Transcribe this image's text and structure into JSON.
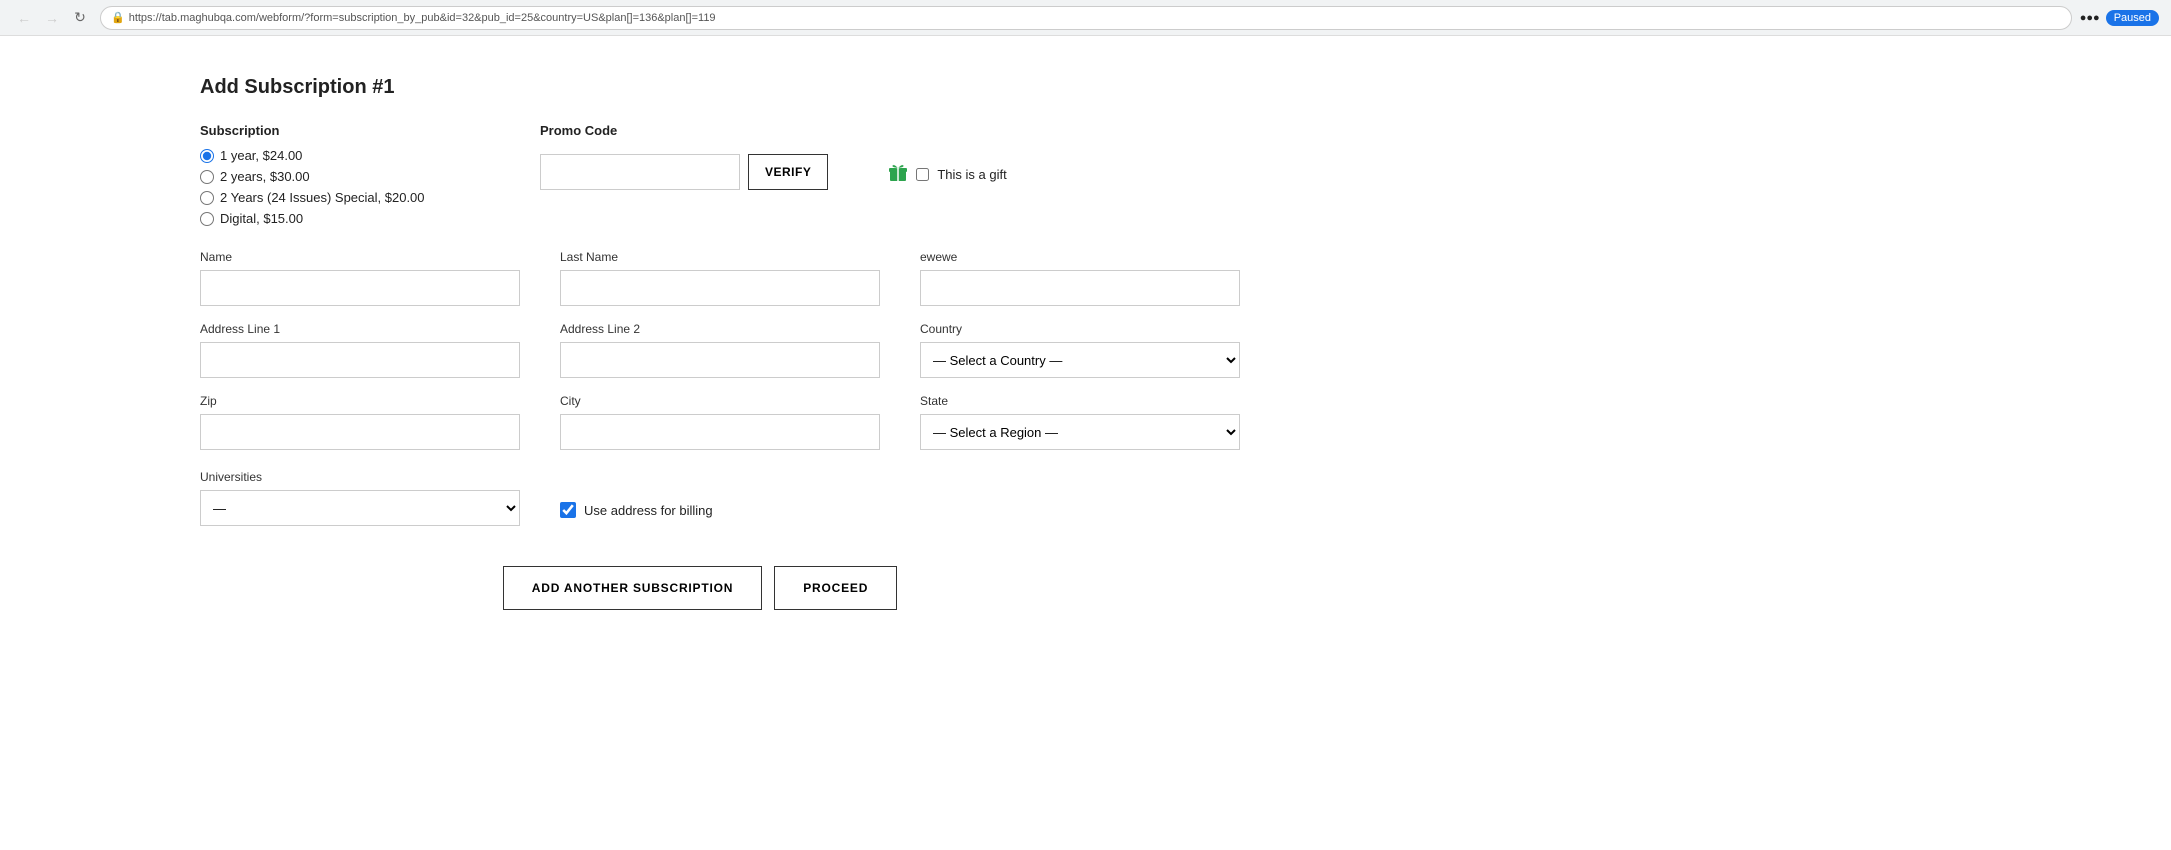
{
  "browser": {
    "url": "https://tab.maghubqa.com/webform/?form=subscription_by_pub&id=32&pub_id=25&country=US&plan[]=136&plan[]=119",
    "status": "Paused"
  },
  "page": {
    "title": "Add Subscription #1"
  },
  "subscription": {
    "label": "Subscription",
    "options": [
      {
        "id": "sub1",
        "label": "1 year, $24.00",
        "checked": true
      },
      {
        "id": "sub2",
        "label": "2 years, $30.00",
        "checked": false
      },
      {
        "id": "sub3",
        "label": "2 Years (24 Issues) Special, $20.00",
        "checked": false
      },
      {
        "id": "sub4",
        "label": "Digital, $15.00",
        "checked": false
      }
    ]
  },
  "promo": {
    "label": "Promo Code",
    "placeholder": "",
    "verify_label": "VERIFY"
  },
  "gift": {
    "label": "This is a gift",
    "checked": false
  },
  "fields": {
    "name": {
      "label": "Name",
      "value": "",
      "placeholder": ""
    },
    "last_name": {
      "label": "Last Name",
      "value": "",
      "placeholder": ""
    },
    "ewewe": {
      "label": "ewewe",
      "value": "",
      "placeholder": ""
    },
    "address_line1": {
      "label": "Address Line 1",
      "value": "",
      "placeholder": ""
    },
    "address_line2": {
      "label": "Address Line 2",
      "value": "",
      "placeholder": ""
    },
    "country": {
      "label": "Country",
      "placeholder": "— Select a Country —",
      "value": ""
    },
    "zip": {
      "label": "Zip",
      "value": "",
      "placeholder": ""
    },
    "city": {
      "label": "City",
      "value": "",
      "placeholder": ""
    },
    "state": {
      "label": "State",
      "placeholder": "— Select a Region —",
      "value": ""
    },
    "universities": {
      "label": "Universities",
      "value": "—",
      "options": [
        "—"
      ]
    }
  },
  "use_address_billing": {
    "label": "Use address for billing",
    "checked": true
  },
  "buttons": {
    "add_another": "ADD ANOTHER SUBSCRIPTION",
    "proceed": "PROCEED"
  }
}
